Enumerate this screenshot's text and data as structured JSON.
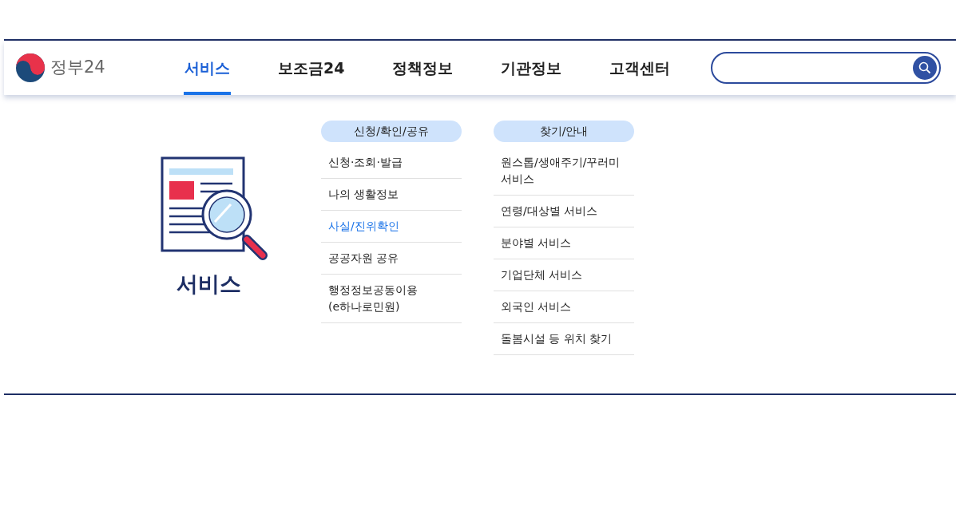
{
  "logo": {
    "text": "정부24"
  },
  "nav": [
    {
      "label": "서비스",
      "selected": true
    },
    {
      "label": "보조금24",
      "selected": false
    },
    {
      "label": "정책정보",
      "selected": false
    },
    {
      "label": "기관정보",
      "selected": false
    },
    {
      "label": "고객센터",
      "selected": false
    }
  ],
  "dropdown": {
    "title": "서비스",
    "groups": [
      {
        "heading": "신청/확인/공유",
        "items": [
          {
            "label": "신청·조회·발급",
            "selected": false
          },
          {
            "label": "나의 생활정보",
            "selected": false
          },
          {
            "label": "사실/진위확인",
            "selected": true
          },
          {
            "label": "공공자원 공유",
            "selected": false
          },
          {
            "label": "행정정보공동이용\n(e하나로민원)",
            "selected": false
          }
        ]
      },
      {
        "heading": "찾기/안내",
        "items": [
          {
            "label": "원스톱/생애주기/꾸러미\n서비스",
            "selected": false
          },
          {
            "label": "연령/대상별 서비스",
            "selected": false
          },
          {
            "label": "분야별 서비스",
            "selected": false
          },
          {
            "label": "기업단체 서비스",
            "selected": false
          },
          {
            "label": "외국인 서비스",
            "selected": false
          },
          {
            "label": "돌봄시설 등 위치 찾기",
            "selected": false
          }
        ]
      }
    ]
  }
}
